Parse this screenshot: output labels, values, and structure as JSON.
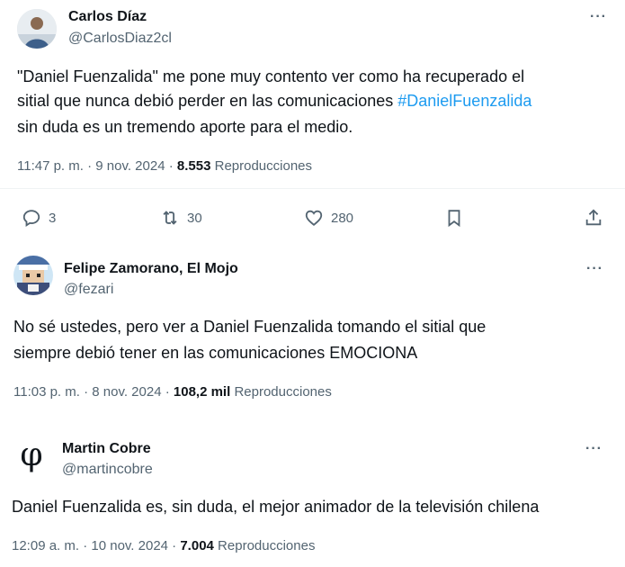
{
  "tweets": [
    {
      "name": "Carlos Díaz",
      "handle": "@CarlosDiaz2cl",
      "text_line1": "\"Daniel Fuenzalida\" me pone muy contento ver como ha recuperado el",
      "text_line2_pre": "sitial que nunca debió perder en las comunicaciones ",
      "text_line2_hashtag": "#DanielFuenzalida",
      "text_line3": "sin duda es un tremendo aporte para el medio.",
      "time": "11:47 p. m. · 9 nov. 2024 · ",
      "views": "8.553",
      "views_label": " Reproducciones",
      "replies": "3",
      "retweets": "30",
      "likes": "280",
      "more": "···"
    },
    {
      "name": "Felipe Zamorano, El Mojo",
      "handle": "@fezari",
      "text_line1": "No sé ustedes, pero ver a Daniel Fuenzalida tomando el sitial que",
      "text_line2": "siempre debió tener en las comunicaciones EMOCIONA",
      "time": "11:03 p. m. · 8 nov. 2024 · ",
      "views": "108,2 mil",
      "views_label": " Reproducciones",
      "more": "···"
    },
    {
      "name": "Martin Cobre",
      "handle": "@martincobre",
      "avatar_glyph": "φ",
      "text_line1": "Daniel Fuenzalida es, sin duda, el mejor animador de la televisión chilena",
      "time": "12:09 a. m. · 10 nov. 2024 · ",
      "views": "7.004",
      "views_label": " Reproducciones",
      "more": "···"
    }
  ],
  "colors": {
    "text": "#0f1419",
    "secondary": "#536471",
    "link": "#1d9bf0",
    "divider": "#eff3f4"
  }
}
